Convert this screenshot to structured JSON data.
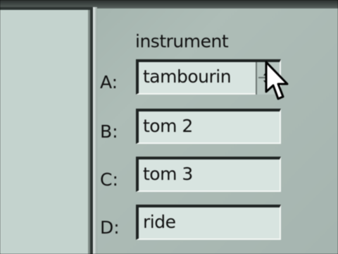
{
  "instrument_panel": {
    "header": "instrument",
    "rows": [
      {
        "label": "A:",
        "value": "tambourin"
      },
      {
        "label": "B:",
        "value": "tom 2"
      },
      {
        "label": "C:",
        "value": "tom 3"
      },
      {
        "label": "D:",
        "value": "ride"
      }
    ]
  },
  "icons": {
    "cursor": "arrow-pointer-icon",
    "spin": "spin-arrows-icon"
  }
}
